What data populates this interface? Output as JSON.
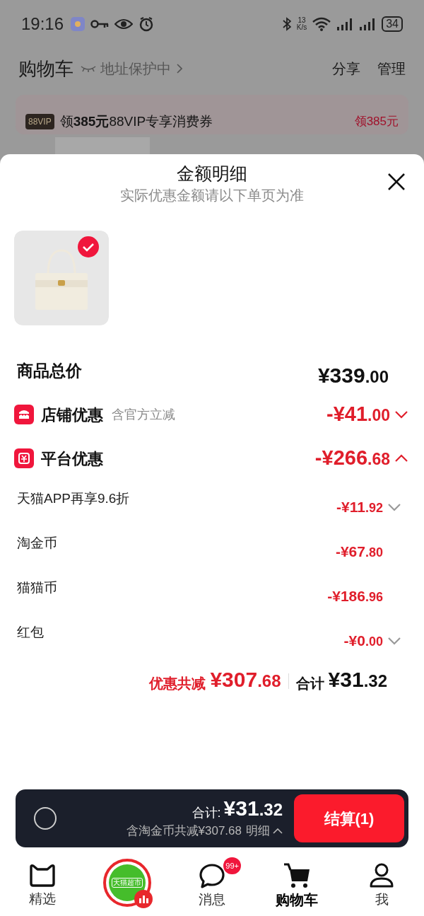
{
  "status_bar": {
    "time": "19:16",
    "net_speed_value": "13",
    "net_speed_unit": "K/s",
    "battery": "34"
  },
  "header": {
    "title": "购物车",
    "address_protection": "地址保护中",
    "actions": [
      "分享",
      "管理"
    ]
  },
  "vip_banner": {
    "badge": "88VIP",
    "text": "领**385元**88VIP专享消费券",
    "action": "领385元"
  },
  "sheet": {
    "title": "金额明细",
    "subtitle": "实际优惠金额请以下单页为准",
    "product": {
      "selected": true
    }
  },
  "total": {
    "label": "商品总价",
    "amount": "¥339.00"
  },
  "discounts": [
    {
      "kind": "store",
      "label": "店铺优惠",
      "note": "含官方立减",
      "amount": "-¥41.00",
      "expanded": false
    },
    {
      "kind": "platform",
      "label": "平台优惠",
      "amount": "-¥266.68",
      "expanded": true,
      "children": [
        {
          "kind": "expandable",
          "label": "天猫APP再享9.6折",
          "amount": "-¥11.92",
          "expanded": false
        },
        {
          "kind": "plain",
          "label": "淘金币",
          "amount": "-¥67.80"
        },
        {
          "kind": "plain",
          "label": "猫猫币",
          "amount": "-¥186.96"
        },
        {
          "kind": "expandable",
          "label": "红包",
          "amount": "-¥0.00",
          "expanded": false
        }
      ]
    }
  ],
  "summary": {
    "savings_label": "优惠共减",
    "savings_amount": "¥307.68",
    "total_label": "合计",
    "total_amount": "¥31.32"
  },
  "checkout_bar": {
    "select_all_checked": false,
    "total_label": "合计:",
    "total_amount": "¥31.32",
    "savings_note": "含淘金币共减¥307.68",
    "details": "明细",
    "button": "结算(1)"
  },
  "tab_bar": [
    {
      "kind": "cat",
      "label": "精选",
      "selected": false
    },
    {
      "kind": "promo",
      "logo_text": "天猫超市",
      "selected": false
    },
    {
      "kind": "chat",
      "label": "消息",
      "badge": "99+",
      "selected": false
    },
    {
      "kind": "cart",
      "label": "购物车",
      "selected": true
    },
    {
      "kind": "person",
      "label": "我",
      "selected": false
    }
  ]
}
